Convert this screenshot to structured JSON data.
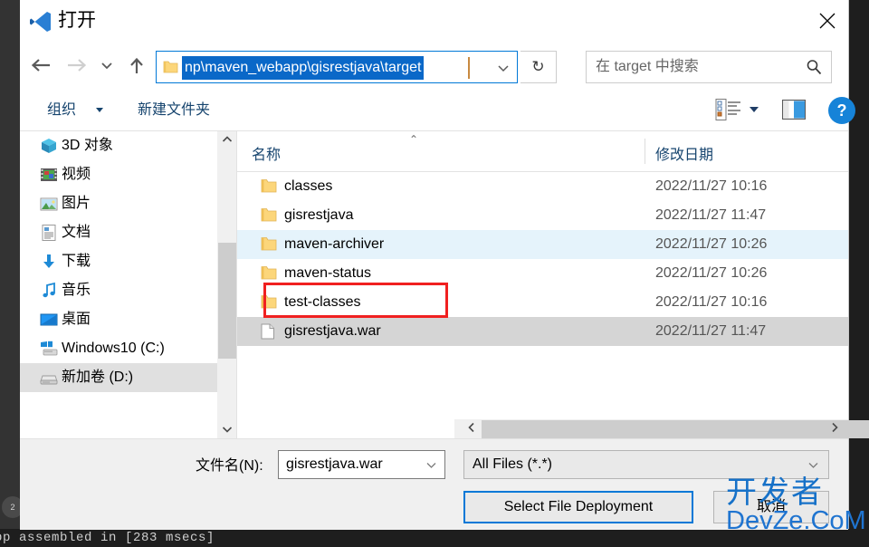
{
  "window": {
    "title": "打开",
    "app_icon": "vscode-icon",
    "close_label": "✕"
  },
  "nav": {
    "back_icon": "arrow-left-icon",
    "forward_icon": "arrow-right-icon",
    "recent_icon": "chevron-down-icon",
    "up_icon": "arrow-up-icon",
    "refresh_label": "↻"
  },
  "address": {
    "folder_icon": "folder-icon",
    "path_text": "np\\maven_webapp\\gisrestjava\\target",
    "chevron_icon": "chevron-down-icon"
  },
  "search": {
    "placeholder": "在 target 中搜索",
    "icon": "search-icon"
  },
  "commandbar": {
    "organize_label": "组织",
    "new_folder_label": "新建文件夹",
    "view_mode_icon": "list-view-icon",
    "preview_pane_icon": "preview-pane-icon",
    "help_label": "?"
  },
  "sidebar": {
    "items": [
      {
        "label": "3D 对象",
        "icon": "3d-objects-icon",
        "selected": false
      },
      {
        "label": "视频",
        "icon": "videos-icon",
        "selected": false
      },
      {
        "label": "图片",
        "icon": "pictures-icon",
        "selected": false
      },
      {
        "label": "文档",
        "icon": "documents-icon",
        "selected": false
      },
      {
        "label": "下载",
        "icon": "downloads-icon",
        "selected": false
      },
      {
        "label": "音乐",
        "icon": "music-icon",
        "selected": false
      },
      {
        "label": "桌面",
        "icon": "desktop-icon",
        "selected": false
      },
      {
        "label": "Windows10 (C:)",
        "icon": "windows-drive-icon",
        "selected": false
      },
      {
        "label": "新加卷 (D:)",
        "icon": "drive-icon",
        "selected": true
      }
    ],
    "scroll_up_icon": "chevron-up-icon",
    "scroll_down_icon": "chevron-down-icon"
  },
  "filelist": {
    "columns": {
      "name": "名称",
      "date_modified": "修改日期"
    },
    "sort_indicator": "⌃",
    "rows": [
      {
        "name": "classes",
        "date": "2022/11/27 10:16",
        "icon": "folder-icon",
        "state": "normal"
      },
      {
        "name": "gisrestjava",
        "date": "2022/11/27 11:47",
        "icon": "folder-icon",
        "state": "normal"
      },
      {
        "name": "maven-archiver",
        "date": "2022/11/27 10:26",
        "icon": "folder-icon",
        "state": "hover"
      },
      {
        "name": "maven-status",
        "date": "2022/11/27 10:26",
        "icon": "folder-icon",
        "state": "normal"
      },
      {
        "name": "test-classes",
        "date": "2022/11/27 10:16",
        "icon": "folder-icon",
        "state": "normal"
      },
      {
        "name": "gisrestjava.war",
        "date": "2022/11/27 11:47",
        "icon": "file-icon",
        "state": "selected"
      }
    ],
    "hscroll_left_icon": "chevron-left-icon",
    "hscroll_right_icon": "chevron-right-icon"
  },
  "footer": {
    "filename_label": "文件名(N):",
    "filename_value": "gisrestjava.war",
    "filename_chevron": "chevron-down-icon",
    "filter_value": "All Files (*.*)",
    "filter_chevron": "chevron-down-icon",
    "open_button": "Select File Deployment",
    "cancel_button": "取消"
  },
  "watermark": {
    "cn": "开发者",
    "en": "DevZe.CoM"
  },
  "background": {
    "terminal_text": "pp assembled in [283 msecs]",
    "activity_badge": "2"
  },
  "colors": {
    "accent": "#0078d7",
    "selection_blue": "#0a68c8",
    "hover_row": "#e5f3fb",
    "selected_row": "#d5d5d5",
    "annotation_red": "#f02020",
    "link_text": "#16446e",
    "watermark_blue": "#1671c8"
  }
}
